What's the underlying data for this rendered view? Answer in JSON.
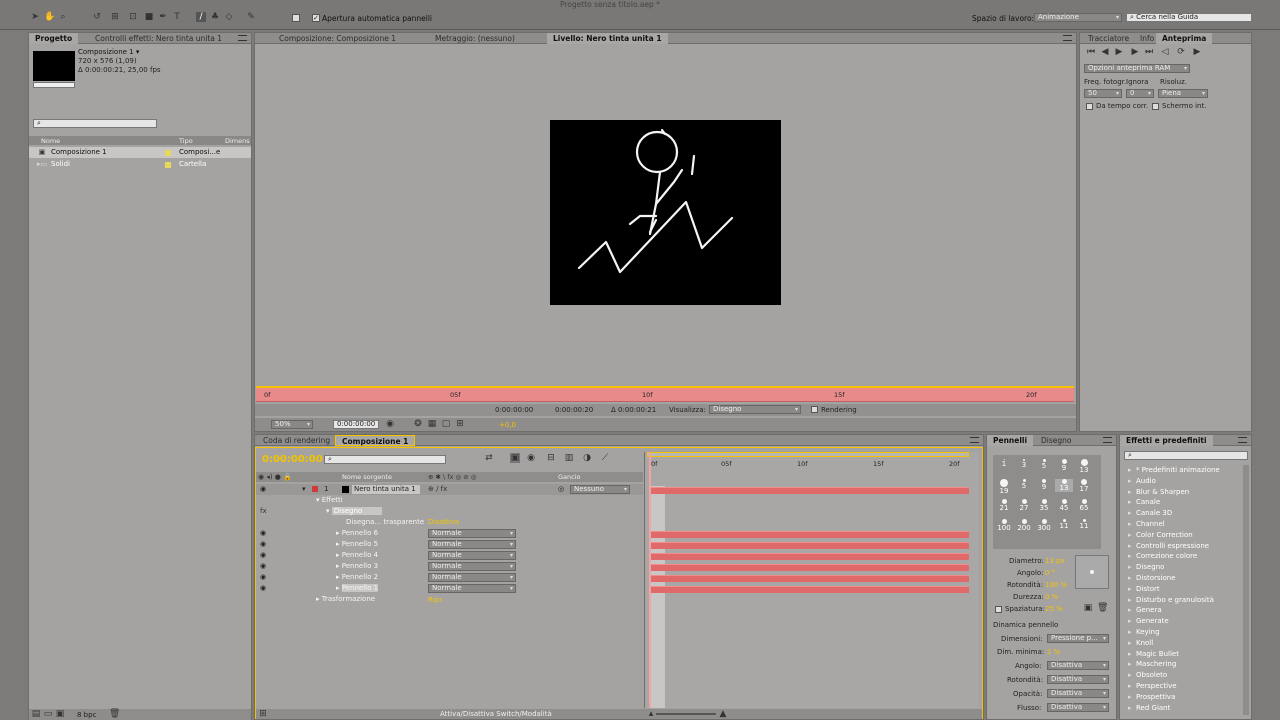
{
  "app": {
    "title": "Progetto senza titolo.aep *",
    "auto_open_panels": "Apertura automatica pannelli",
    "workspace_label": "Spazio di lavoro:",
    "workspace_value": "Animazione",
    "help_placeholder": "Cerca nella Guida"
  },
  "project": {
    "tab": "Progetto",
    "effects_tab": "Controlli effetti: Nero tinta unita 1",
    "comp_name": "Composizione 1 ▾",
    "comp_size": "720 x 576 (1,09)",
    "comp_duration": "Δ 0:00:00:21, 25,00 fps",
    "col_name": "Nome",
    "col_type": "Tipo",
    "col_dim": "Dimens",
    "items": [
      {
        "name": "Composizione 1",
        "type": "Composi...e"
      },
      {
        "name": "Solidi",
        "type": "Cartella"
      }
    ],
    "bpc": "8 bpc"
  },
  "viewer": {
    "tab_comp": "Composizione: Composizione 1",
    "tab_footage": "Metraggio: (nessuno)",
    "tab_layer": "Livello: Nero tinta unita 1",
    "ruler": [
      "0f",
      "05f",
      "10f",
      "15f",
      "20f"
    ],
    "time_current": "0:00:00:00",
    "time_end": "0:00:00:20",
    "time_dur": "Δ 0:00:00:21",
    "view_label": "Visualizza:",
    "view_value": "Disegno",
    "rendering": "Rendering",
    "zoom": "50%",
    "timecode": "0:00:00:00",
    "exposure": "+0,0"
  },
  "timeline": {
    "tab_render": "Coda di rendering",
    "tab_comp": "Composizione 1",
    "timecode": "0:00:00:00",
    "col_source": "Nome sorgente",
    "col_parent": "Gancio",
    "ruler": [
      "0f",
      "05f",
      "10f",
      "15f",
      "20f"
    ],
    "layer_num": "1",
    "layer_name": "Nero tinta unita 1",
    "parent_value": "Nessuno",
    "effects": "Effetti",
    "paint": "Disegno",
    "paint_transparent_label": "Disegna... trasparente",
    "paint_transparent_value": "Disattiva",
    "brushes": [
      {
        "name": "Pennello 6",
        "mode": "Normale"
      },
      {
        "name": "Pennello 5",
        "mode": "Normale"
      },
      {
        "name": "Pennello 4",
        "mode": "Normale"
      },
      {
        "name": "Pennello 3",
        "mode": "Normale"
      },
      {
        "name": "Pennello 2",
        "mode": "Normale"
      },
      {
        "name": "Pennello 1",
        "mode": "Normale"
      }
    ],
    "transform": "Trasformazione",
    "transform_value": "Ripr.",
    "toggle": "Attiva/Disattiva Switch/Modalità"
  },
  "right_top": {
    "tabs": [
      "Tracciatore",
      "Info",
      "Anteprima"
    ],
    "ram_options": "Opzioni anteprima RAM",
    "frame_rate_label": "Freq. fotogr.",
    "skip_label": "Ignora",
    "resolution_label": "Risoluz.",
    "frame_rate": "50",
    "skip": "0",
    "resolution": "Piena",
    "from_current": "Da tempo corr.",
    "full_screen": "Schermo int."
  },
  "brushes_panel": {
    "tabs": [
      "Pennelli",
      "Disegno"
    ],
    "sizes": [
      "1",
      "3",
      "5",
      "9",
      "13",
      "19",
      "5",
      "9",
      "13",
      "17",
      "21",
      "27",
      "35",
      "45",
      "65",
      "100",
      "200",
      "300",
      "11",
      "11"
    ],
    "diameter_label": "Diametro:",
    "diameter": "13 px",
    "angle_label": "Angolo:",
    "angle": "0 °",
    "roundness_label": "Rotondità:",
    "roundness": "100 %",
    "hardness_label": "Durezza:",
    "hardness": "0 %",
    "spacing_label": "Spaziatura:",
    "spacing": "25 %",
    "dynamics": "Dinamica pennello",
    "dyn_size_label": "Dimensioni:",
    "dyn_size": "Pressione p...",
    "min_size_label": "Dim. minima:",
    "min_size": "1 %",
    "dyn_angle_label": "Angolo:",
    "dyn_angle": "Disattiva",
    "dyn_round_label": "Rotondità:",
    "dyn_round": "Disattiva",
    "dyn_opacity_label": "Opacità:",
    "dyn_opacity": "Disattiva",
    "dyn_flow_label": "Flusso:",
    "dyn_flow": "Disattiva"
  },
  "effects_panel": {
    "tab": "Effetti e predefiniti",
    "items": [
      "* Predefiniti animazione",
      "Audio",
      "Blur & Sharpen",
      "Canale",
      "Canale 3D",
      "Channel",
      "Color Correction",
      "Controlli espressione",
      "Correzione colore",
      "Disegno",
      "Distorsione",
      "Distort",
      "Disturbo e granulosità",
      "Genera",
      "Generate",
      "Keying",
      "Knoll",
      "Magic Bullet",
      "Maschering",
      "Obsoleto",
      "Perspective",
      "Prospettiva",
      "Red Giant"
    ]
  }
}
